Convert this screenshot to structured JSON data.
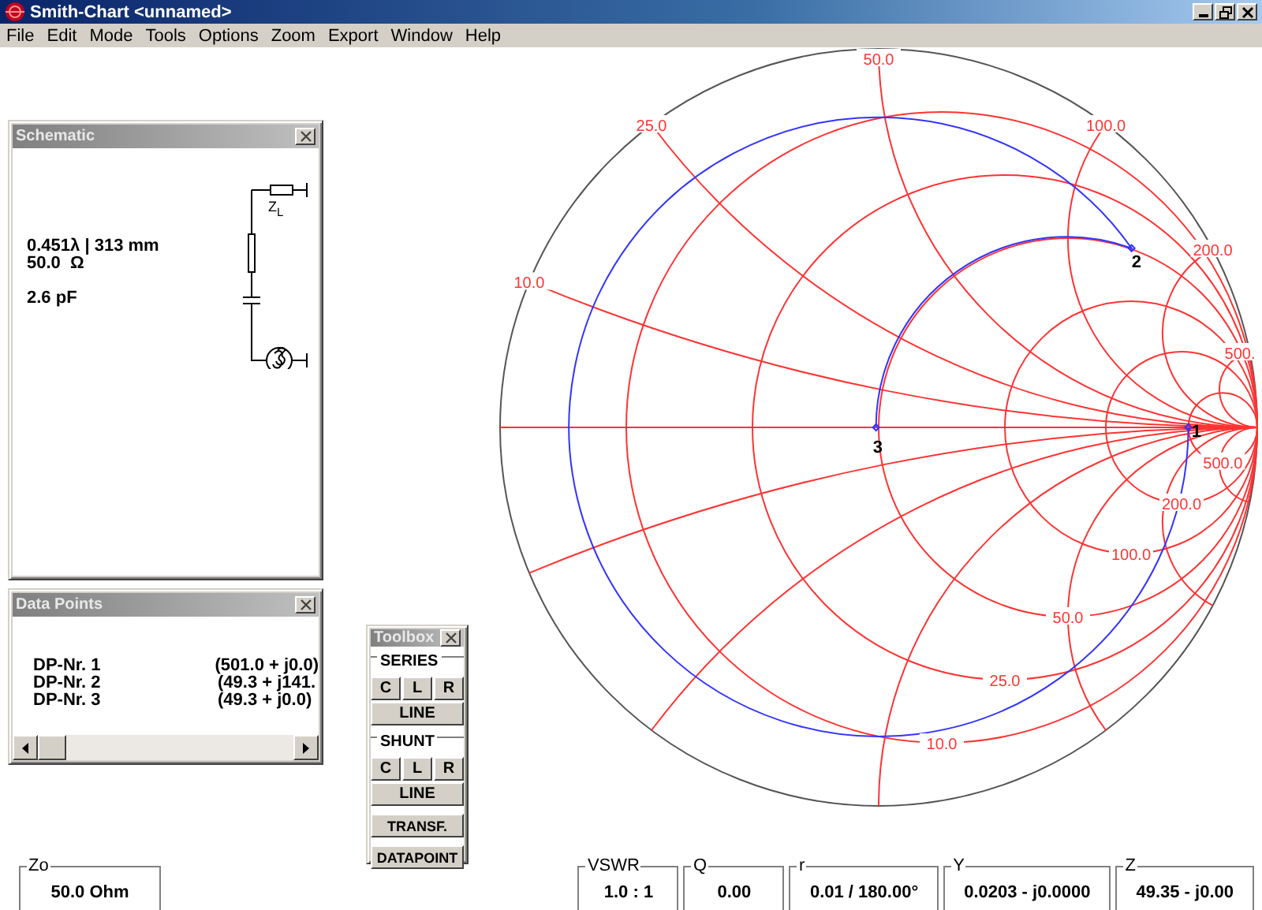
{
  "window": {
    "title": "Smith-Chart <unnamed>"
  },
  "menu": [
    "File",
    "Edit",
    "Mode",
    "Tools",
    "Options",
    "Zoom",
    "Export",
    "Window",
    "Help"
  ],
  "schematic": {
    "title": "Schematic",
    "line": "0.451λ | 313 mm",
    "impedance": "50.0  Ω",
    "capacitance": "2.6 pF",
    "load_label": "Z$_{L}$"
  },
  "data_points": {
    "title": "Data Points",
    "rows": [
      {
        "name": "DP-Nr. 1",
        "value": "(501.0 + j0.0)"
      },
      {
        "name": "DP-Nr. 2",
        "value": "(49.3 + j141."
      },
      {
        "name": "DP-Nr. 3",
        "value": "(49.3 + j0.0)"
      }
    ]
  },
  "toolbox": {
    "title": "Toolbox",
    "groups": [
      {
        "label": "SERIES",
        "buttons": [
          "C",
          "L",
          "R"
        ],
        "line": "LINE"
      },
      {
        "label": "SHUNT",
        "buttons": [
          "C",
          "L",
          "R"
        ],
        "line": "LINE"
      }
    ],
    "buttons": [
      "TRANSF.",
      "DATAPOINT"
    ]
  },
  "smith_chart": {
    "reactance_labels": [
      "10.0",
      "25.0",
      "50.0",
      "100.0",
      "200.0",
      "500."
    ],
    "resistance_labels": [
      "10.0",
      "25.0",
      "50.0",
      "100.0",
      "200.0",
      "500.0"
    ],
    "markers": [
      {
        "label": "1"
      },
      {
        "label": "2"
      },
      {
        "label": "3"
      }
    ]
  },
  "readouts": [
    {
      "label": "Zo",
      "value": "50.0 Ohm"
    },
    {
      "label": "VSWR",
      "value": "1.0 : 1"
    },
    {
      "label": "Q",
      "value": "0.00"
    },
    {
      "label": "r",
      "value": "0.01 / 180.00°"
    },
    {
      "label": "Y",
      "value": "0.0203 - j0.0000"
    },
    {
      "label": "Z",
      "value": "49.35 - j0.00"
    }
  ]
}
